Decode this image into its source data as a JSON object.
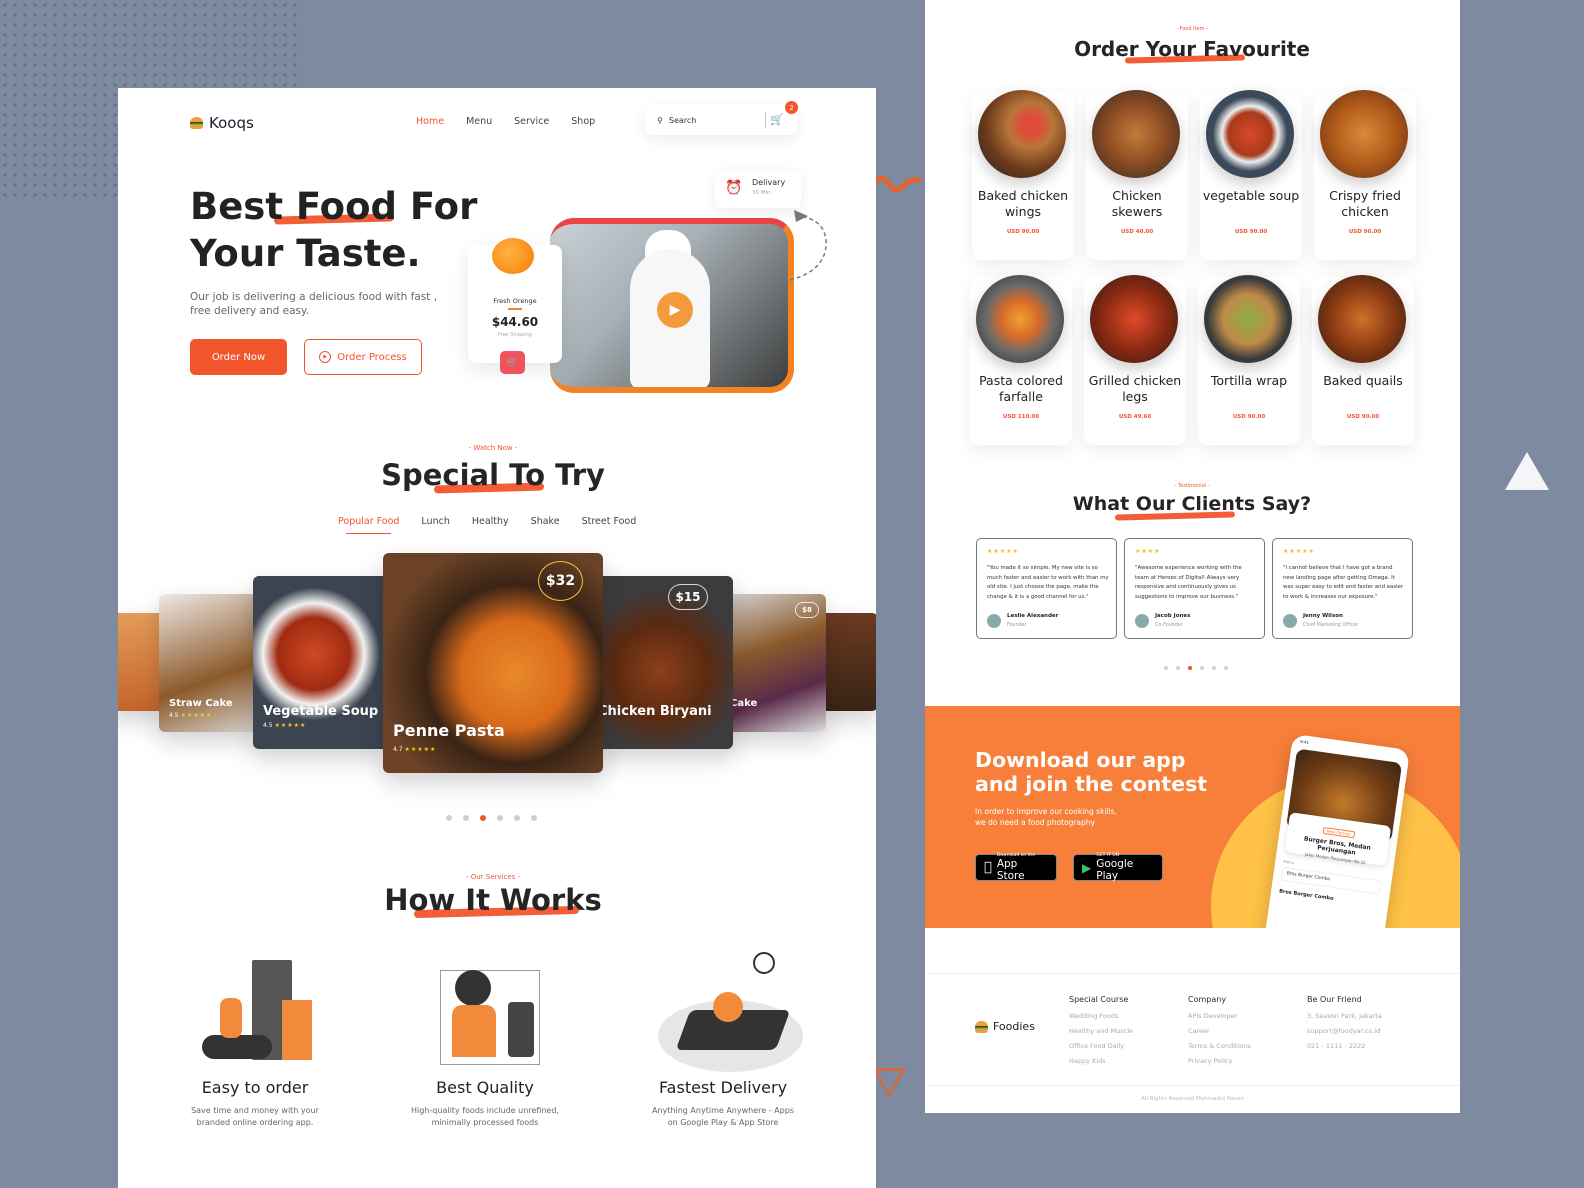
{
  "landing": {
    "brand": "Kooqs",
    "nav": [
      "Home",
      "Menu",
      "Service",
      "Shop"
    ],
    "nav_active": "Home",
    "search_placeholder": "Search",
    "cart_count": "2",
    "hero": {
      "title_line1": "Best Food For",
      "title_line2": "Your Taste.",
      "subtitle": "Our job is delivering a delicious food with fast , free delivery and easy.",
      "order_now": "Order Now",
      "order_process": "Order Process"
    },
    "delivery": {
      "label": "Delivary",
      "time": "30 Min"
    },
    "promo": {
      "name": "Fresh Orenge",
      "price": "$44.60",
      "shipping": "Free Shipping"
    },
    "special": {
      "eyebrow": "- Watch Now -",
      "title": "Special To Try",
      "tabs": [
        "Popular Food",
        "Lunch",
        "Healthy",
        "Shake",
        "Street Food"
      ],
      "active_tab": "Popular Food",
      "cards": [
        {
          "name": "Straw Cake",
          "rating": "4.5"
        },
        {
          "name": "Vegetable Soup",
          "rating": "4.5"
        },
        {
          "name": "Penne Pasta",
          "rating": "4.7",
          "price": "$32"
        },
        {
          "name": "Chicken Biryani",
          "price": "$15"
        },
        {
          "name": "Cake",
          "price": "$8"
        }
      ],
      "carousel_pages": 6,
      "carousel_active": 3
    },
    "how": {
      "eyebrow": "- Our Services -",
      "title": "How It Works",
      "items": [
        {
          "title": "Easy to order",
          "text": "Save time and money with your branded online ordering app."
        },
        {
          "title": "Best Quality",
          "text": "High-quality foods include unrefined, minimally processed foods"
        },
        {
          "title": "Fastest Delivery",
          "text": "Anything Anytime Anywhere - Apps on Google Play & App Store"
        }
      ]
    }
  },
  "menu_page": {
    "eyebrow": "- Food Item -",
    "title": "Order Your Favourite",
    "items": [
      {
        "name": "Baked chicken wings",
        "price": "USD 90.00"
      },
      {
        "name": "Chicken skewers",
        "price": "USD 40.00"
      },
      {
        "name": "vegetable soup",
        "price": "USD 90.00"
      },
      {
        "name": "Crispy fried chicken",
        "price": "USD 90.00"
      },
      {
        "name": "Pasta colored farfalle",
        "price": "USD 110.00"
      },
      {
        "name": "Grilled chicken legs",
        "price": "USD 49.60"
      },
      {
        "name": "Tortilla wrap",
        "price": "USD 90.00"
      },
      {
        "name": "Baked quails",
        "price": "USD 90.00"
      }
    ],
    "testimonial": {
      "eyebrow": "- Testimonial -",
      "title": "What Our Clients Say?",
      "cards": [
        {
          "stars": "★★★★★",
          "quote": "\"You made it so simple. My new site is so much faster and easier to work with than my old site. I just choose the page, make the change & it is a good channel for us.\"",
          "name": "Leslie Alexander",
          "role": "Founder"
        },
        {
          "stars": "★★★★",
          "quote": "\"Awesome experience working with the team at Heroes of Digital! Always very responsive and continuously gives us suggestions to improve our business.\"",
          "name": "Jacob Jones",
          "role": "Co-Founder"
        },
        {
          "stars": "★★★★★",
          "quote": "\"I cannot believe that I have got a brand new landing page after getting Omega. It was super easy to edit and faster and easier to work & increases our exposure.\"",
          "name": "Jenny Wilson",
          "role": "Chief Marketing Officer"
        }
      ],
      "pages": 6,
      "active": 3
    },
    "app": {
      "title_line1": "Download our app",
      "title_line2": "and join the contest",
      "text_line1": "In order to improve our cooking skills,",
      "text_line2": "we do need a food photography",
      "appstore_small": "Download on the",
      "appstore_big": "App Store",
      "play_small": "GET IT ON",
      "play_big": "Google Play",
      "phone": {
        "time": "9:41",
        "tag": "New Partner",
        "restaurant": "Burger Bros, Medan Perjuangan",
        "address": "Jalan Medan Perjuangan No.32",
        "menu_label": "Menu",
        "selected": "Bros Burger Combo",
        "section": "Bros Burger Combo"
      }
    },
    "footer": {
      "brand": "Foodies",
      "columns": [
        {
          "title": "Special Course",
          "links": [
            "Wedding Foods",
            "Healthy and Muscle",
            "Office Food Daily",
            "Happy Kids"
          ]
        },
        {
          "title": "Company",
          "links": [
            "APIs Developer",
            "Career",
            "Terms & Conditions",
            "Privacy Policy"
          ]
        },
        {
          "title": "Be Our Friend",
          "links": [
            "3, Season Park, Jakarta",
            "support@foodyar.co.id",
            "021 - 1111 - 2222"
          ]
        }
      ],
      "copyright": "All Rights Reserved Mahmadul Hasan"
    }
  },
  "colors": {
    "accent": "#f2552c",
    "app_banner": "#f77f3a",
    "star": "#f9c623",
    "background": "#7e8aa0"
  }
}
